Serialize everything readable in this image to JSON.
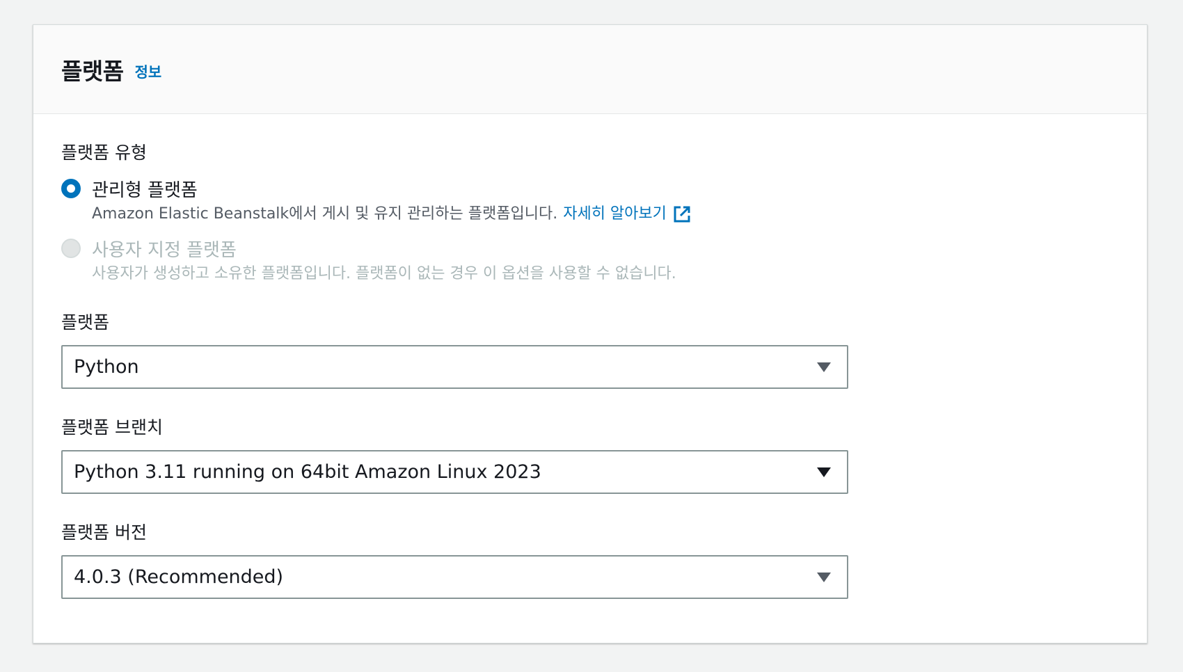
{
  "panel": {
    "title": "플랫폼",
    "info_link": "정보"
  },
  "platform_type": {
    "label": "플랫폼 유형",
    "options": [
      {
        "label": "관리형 플랫폼",
        "description": "Amazon Elastic Beanstalk에서 게시 및 유지 관리하는 플랫폼입니다.",
        "link_text": "자세히 알아보기",
        "link_icon": "external-link-icon",
        "selected": true,
        "disabled": false
      },
      {
        "label": "사용자 지정 플랫폼",
        "description": "사용자가 생성하고 소유한 플랫폼입니다. 플랫폼이 없는 경우 이 옵션을 사용할 수 없습니다.",
        "selected": false,
        "disabled": true
      }
    ]
  },
  "platform": {
    "label": "플랫폼",
    "value": "Python"
  },
  "platform_branch": {
    "label": "플랫폼 브랜치",
    "value": "Python 3.11 running on 64bit Amazon Linux 2023"
  },
  "platform_version": {
    "label": "플랫폼 버전",
    "value": "4.0.3 (Recommended)"
  },
  "colors": {
    "accent": "#0073bb",
    "text": "#16191f",
    "muted": "#545b64",
    "disabled": "#aab7b8",
    "background": "#f2f3f3"
  }
}
